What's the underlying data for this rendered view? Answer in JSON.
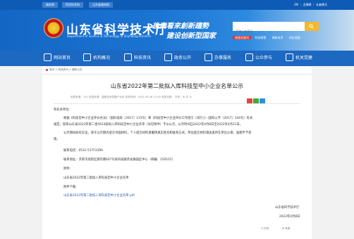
{
  "topbar": {
    "links": [
      "政务网",
      "科学技术协",
      "山东省政府网"
    ],
    "right": "EN ｜ 无障碍 ｜ 长者模式"
  },
  "header": {
    "title": "山东省科学技术厅",
    "subtitle": "Department of Science & Technology of Shandong Province",
    "slogan_line1": "後高看來創新趨勢",
    "slogan_line2": "建设创新型国家",
    "search_placeholder": "请输入关键词",
    "hot_label": "热搜关键词",
    "hot_words": [
      "科技政策",
      "高新技术",
      "科技奖励"
    ]
  },
  "nav": {
    "items": [
      "网站首页",
      "机构概况",
      "科技资讯",
      "政务公开",
      "办事服务",
      "公众参与",
      "机关党建"
    ]
  },
  "breadcrumb": "首页 > 科技资讯 > 通知公告",
  "article": {
    "title": "山东省2022年第二批拟入库科技型中小企业名单公示",
    "meta": "信息来源：152        信息来源：高新技术发展产业处        发布时间：2022-04-08 12:00    浏览次数：      字号：大 中 小",
    "greeting": "各有关单位：",
    "para1_line1": "根据《科技型中小企业评价办法》（国科发政〔2017〕115号）和《科技型中小企业评价工作指引（试行）》（国科火字〔2017〕144号）有关",
    "para1_line2": "规定。现将山东省2022年第二批5614家拟入库科技型中小企业名单（详见附件）予以公示，公示时间自2022年4月8日至2022年4月21日。",
    "para2_line1": "公示期间如有异议，请于公示期内提交书面材料，个人提交材料请署明真实姓名和联系方式，单位提交材料请加盖所在单位公章，逾期不予受",
    "para2_line2": "理。",
    "phone": "联系电话：0531-51751589",
    "address": "联系地址：济南市高新区舜华路607号省科技服务发展园区中心（邮编：250101）",
    "attachment_label": "附件：",
    "attachment_name": "山东省2022年第二批拟入库科技型中小企业名单",
    "download_label": "附件下载：",
    "download_link": "山东省2022年第二批拟入库科技型中小企业名单.pdf",
    "sign_org": "山东省科学技术厅",
    "sign_date": "2022年4月8日",
    "footer_print": "打印",
    "footer_close": "关闭"
  },
  "colors": {
    "primary": "#1466c4",
    "nav": "#1d68c0",
    "accent": "#f4b72d",
    "link": "#2357b2"
  }
}
